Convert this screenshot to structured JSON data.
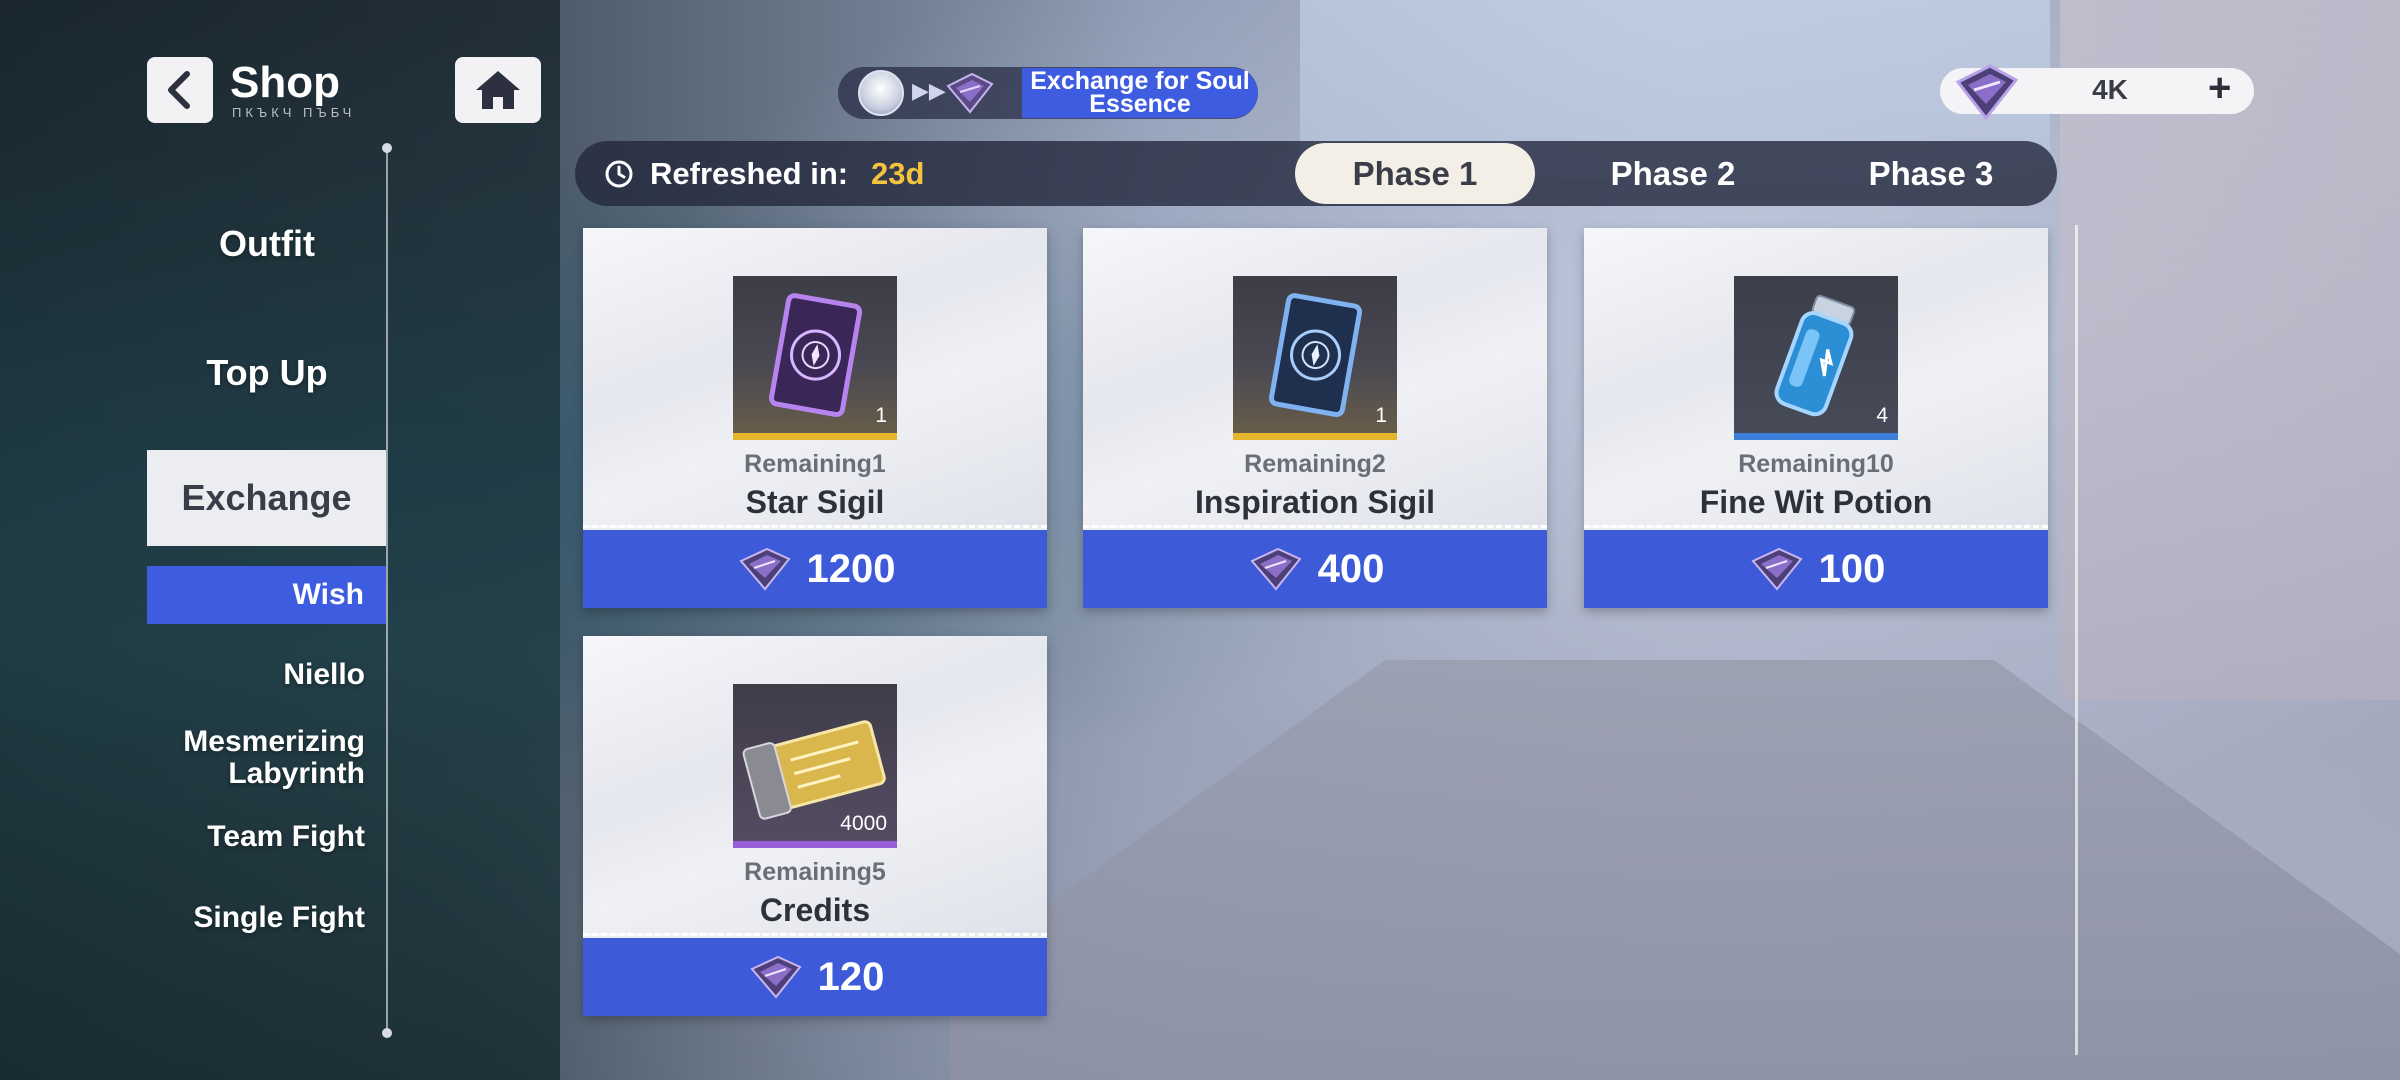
{
  "header": {
    "title": "Shop",
    "subtitle": "ПКЪКЧ ПЪБЧ"
  },
  "sidebar": {
    "items": [
      {
        "label": "Outfit"
      },
      {
        "label": "Top Up"
      },
      {
        "label": "Exchange",
        "active": true
      }
    ],
    "sub_items": [
      {
        "label": "Wish",
        "active": true
      },
      {
        "label": "Niello"
      },
      {
        "label": "Mesmerizing Labyrinth"
      },
      {
        "label": "Team Fight"
      },
      {
        "label": "Single Fight"
      }
    ]
  },
  "exchange_pill": {
    "label": "Exchange for Soul Essence"
  },
  "currency": {
    "value": "4K",
    "plus": "+",
    "icon": "soul-essence-gem-icon"
  },
  "refresh": {
    "label": "Refreshed in:",
    "value": "23d"
  },
  "phases": [
    {
      "label": "Phase 1",
      "active": true
    },
    {
      "label": "Phase 2"
    },
    {
      "label": "Phase 3"
    }
  ],
  "items": [
    {
      "name": "Star Sigil",
      "remaining": "Remaining1",
      "count": "1",
      "price": "1200",
      "rarity_color": "#e5b52b"
    },
    {
      "name": "Inspiration Sigil",
      "remaining": "Remaining2",
      "count": "1",
      "price": "400",
      "rarity_color": "#e5b52b"
    },
    {
      "name": "Fine Wit Potion",
      "remaining": "Remaining10",
      "count": "4",
      "price": "100",
      "rarity_color": "#3d7fd8"
    },
    {
      "name": "Credits",
      "remaining": "Remaining5",
      "count": "4000",
      "price": "120",
      "rarity_color": "#9a5dd8"
    }
  ],
  "colors": {
    "accent_blue": "#3d5ad8",
    "highlight_yellow": "#f4c53c"
  }
}
